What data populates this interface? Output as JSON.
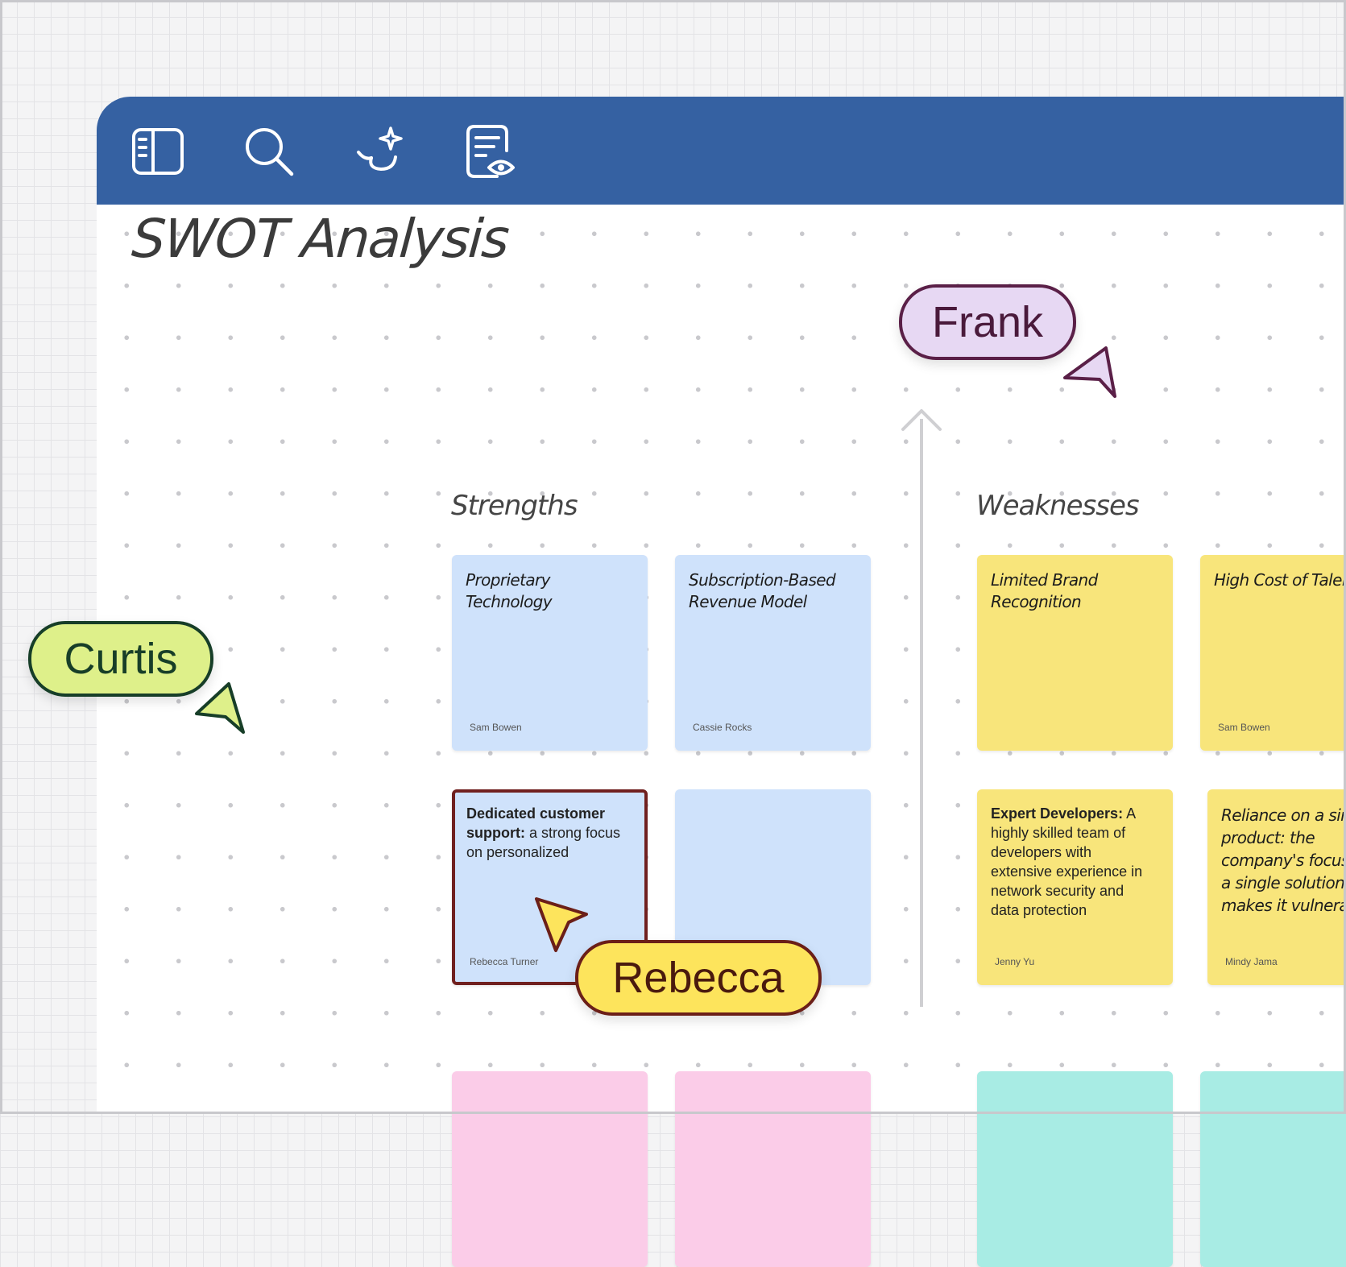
{
  "board": {
    "title": "SWOT Analysis",
    "sections": {
      "strengths": "Strengths",
      "weaknesses": "Weaknesses"
    }
  },
  "toolbar": {
    "icons": [
      "sidebar-panel-icon",
      "search-icon",
      "ai-sparkle-icon",
      "document-review-icon"
    ]
  },
  "notes": {
    "strengths": [
      {
        "title": "Proprietary Technology",
        "author": "Sam Bowen",
        "color": "#cfe2fb"
      },
      {
        "title": "Subscription-Based Revenue Model",
        "author": "Cassie Rocks",
        "color": "#cfe2fb"
      },
      {
        "title_bold": "Dedicated customer support:",
        "body": " a strong focus on personalized",
        "author": "Rebecca Turner",
        "color": "#cfe2fb"
      },
      {
        "title": "",
        "author": "",
        "color": "#cfe2fb"
      }
    ],
    "weaknesses": [
      {
        "title": "Limited Brand Recognition",
        "author": "",
        "color": "#f8e57b"
      },
      {
        "title": "High Cost of Talent",
        "author": "Sam Bowen",
        "color": "#f8e57b"
      },
      {
        "title_bold": "Expert Developers:",
        "body": " A highly skilled team of developers with extensive experience in network security and data protection",
        "author": "Jenny Yu",
        "color": "#f8e57b"
      },
      {
        "title": "Reliance on a single product: the company's focus on a single solution makes it vulnerable",
        "author": "Mindy Jama",
        "color": "#f8e57b"
      }
    ]
  },
  "collaborators": [
    {
      "name": "Frank",
      "bg": "#e7d8f3",
      "border": "#5a1f47",
      "text": "#4a1a3b"
    },
    {
      "name": "Curtis",
      "bg": "#def08a",
      "border": "#173e28",
      "text": "#173e28"
    },
    {
      "name": "Rebecca",
      "bg": "#fde45c",
      "border": "#6b1f18",
      "text": "#4a1a0e"
    }
  ],
  "colors": {
    "toolbar": "#3561a2",
    "axis": "#cfcfd2"
  }
}
